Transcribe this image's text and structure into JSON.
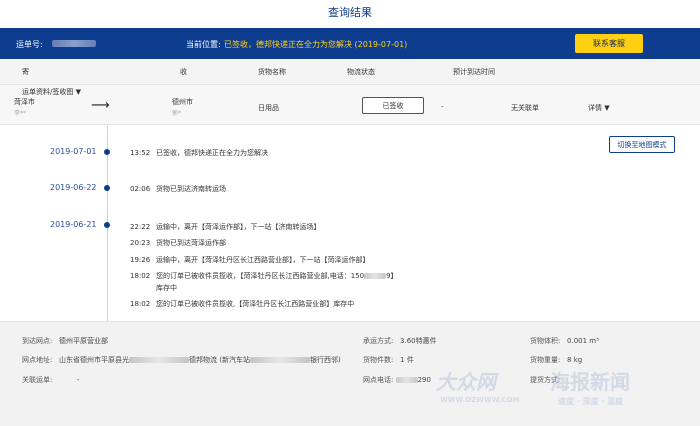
{
  "page": {
    "title": "查询结果"
  },
  "waybill": {
    "label": "运单号:",
    "location_label": "当前位置:",
    "location_value": "已签收，德邦快递正在全力为您解决 (2019-07-01)",
    "service_button": "联系客服"
  },
  "table": {
    "headers": [
      "寄",
      "收",
      "货物名称",
      "物流状态",
      "预计到达时间"
    ],
    "row": {
      "from_city": "菏泽市",
      "from_name": "李**",
      "to_city": "德州市",
      "to_name": "郭*",
      "goods": "日用品",
      "status": "已签收",
      "eta": "-",
      "association": "无关联单",
      "detail": "详情"
    }
  },
  "map_toggle": "切换至地图模式",
  "timeline": [
    {
      "date": "2019-07-01",
      "events": [
        {
          "time": "13:52",
          "text": "已签收，德邦快递正在全力为您解决"
        }
      ]
    },
    {
      "date": "2019-06-22",
      "events": [
        {
          "time": "02:06",
          "text": "货物已到达济南转运场"
        }
      ]
    },
    {
      "date": "2019-06-21",
      "events": [
        {
          "time": "22:22",
          "text": "运输中，离开【菏泽运作部】，下一站【济南转运场】"
        },
        {
          "time": "20:23",
          "text": "货物已到达菏泽运作部"
        },
        {
          "time": "19:26",
          "text": "运输中，离开【菏泽牡丹区长江西路营业部】，下一站【菏泽运作部】"
        },
        {
          "time": "18:02",
          "text_a": "您的订单已被收件员揽收，【菏泽牡丹区长江西路营业部,电话：150",
          "text_b": "9】",
          "text_c": "库存中"
        },
        {
          "time": "18:02",
          "text": "您的订单已被收件员揽收,【菏泽牡丹区长江西路营业部】库存中"
        }
      ]
    }
  ],
  "footer": {
    "arrival_label": "到达网点:",
    "arrival_value": "德州平原营业部",
    "address_label": "网点地址:",
    "address_value_a": "山东省德州市平原县光",
    "address_value_b": "德邦物流 (新汽车站",
    "address_value_c": "银行西邻)",
    "linked_label": "关联运单:",
    "linked_value": "-",
    "transport_label": "承运方式:",
    "transport_value": "3.60特惠件",
    "pieces_label": "货物件数:",
    "pieces_value": "1 件",
    "phone_label": "网点电话:",
    "phone_value": "290",
    "volume_label": "货物体积:",
    "volume_value": "0.001 m³",
    "weight_label": "货物重量:",
    "weight_value": "8 kg",
    "pickup_label": "提货方式:",
    "waybill_sign_link": "运单资料/签收图",
    "watermark_a": "大众网",
    "watermark_b": "海报新闻",
    "watermark_c": "WWW.DZWWW.COM",
    "watermark_d": "速度 · 深度 · 温度"
  }
}
